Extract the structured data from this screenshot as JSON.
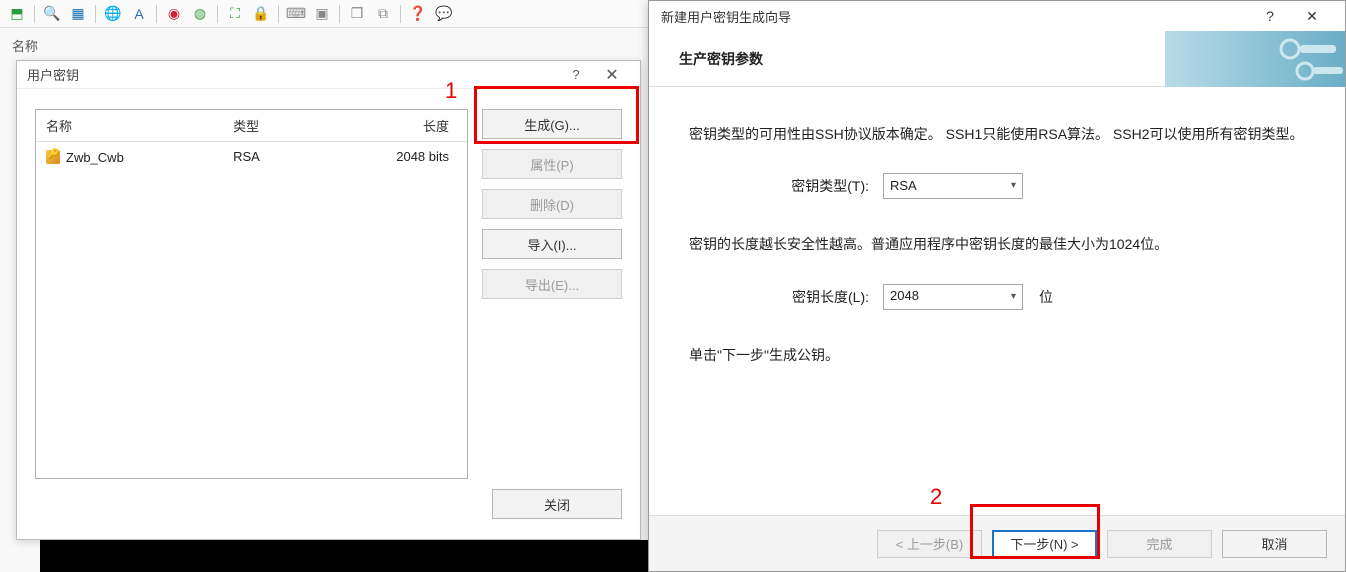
{
  "background": {
    "name_label": "名称"
  },
  "userkeys_dialog": {
    "title": "用户密钥",
    "columns": {
      "name": "名称",
      "type": "类型",
      "length": "长度"
    },
    "rows": [
      {
        "name": "Zwb_Cwb",
        "type": "RSA",
        "length": "2048 bits"
      }
    ],
    "buttons": {
      "generate": "生成(G)...",
      "properties": "属性(P)",
      "delete": "删除(D)",
      "import": "导入(I)...",
      "export": "导出(E)..."
    },
    "close": "关闭",
    "annotations": {
      "num1": "1"
    }
  },
  "wizard": {
    "title": "新建用户密钥生成向导",
    "header": "生产密钥参数",
    "para_type": "密钥类型的可用性由SSH协议版本确定。 SSH1只能使用RSA算法。 SSH2可以使用所有密钥类型。",
    "label_type": "密钥类型(T):",
    "value_type": "RSA",
    "para_length": "密钥的长度越长安全性越高。普通应用程序中密钥长度的最佳大小为1024位。",
    "label_length": "密钥长度(L):",
    "value_length": "2048",
    "unit_length": "位",
    "para_next": "单击\"下一步\"生成公钥。",
    "buttons": {
      "back": "< 上一步(B)",
      "next": "下一步(N) >",
      "finish": "完成",
      "cancel": "取消"
    },
    "annotations": {
      "num2": "2"
    }
  }
}
